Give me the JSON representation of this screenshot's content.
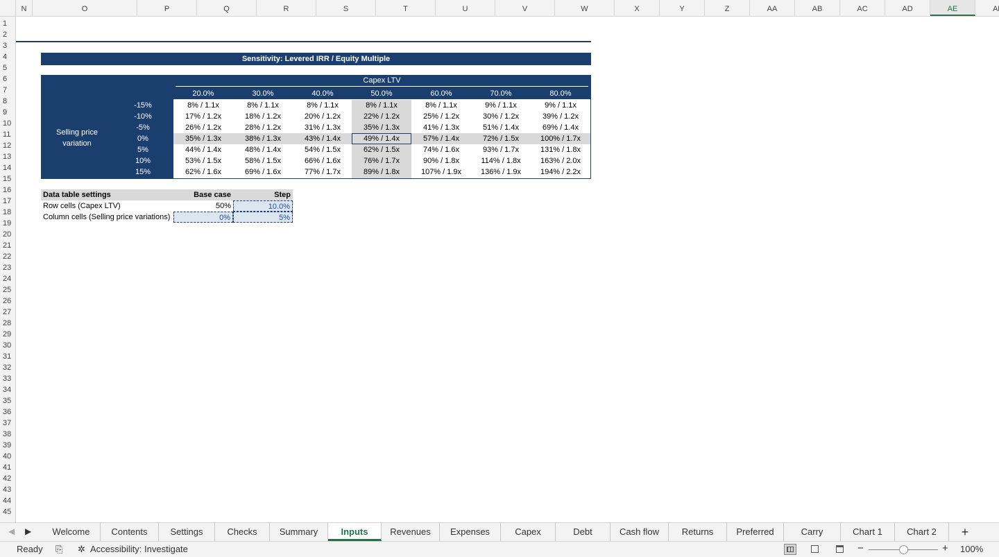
{
  "columns": [
    "N",
    "O",
    "P",
    "Q",
    "R",
    "S",
    "T",
    "U",
    "V",
    "W",
    "X",
    "Y",
    "Z",
    "AA",
    "AB",
    "AC",
    "AD",
    "AE",
    "AF"
  ],
  "selected_column": "AE",
  "rows": [
    "1",
    "2",
    "3",
    "4",
    "5",
    "6",
    "7",
    "8",
    "9",
    "10",
    "11",
    "12",
    "13",
    "14",
    "15",
    "16",
    "17",
    "18",
    "19",
    "20",
    "21",
    "22",
    "23",
    "24",
    "25",
    "26",
    "27",
    "28",
    "29",
    "30",
    "31",
    "32",
    "33",
    "34",
    "35",
    "36",
    "37",
    "38",
    "39",
    "40",
    "41",
    "42",
    "43",
    "44",
    "45"
  ],
  "sheet": {
    "title": "Sensitivity: Levered IRR / Equity Multiple",
    "col_axis_label": "Capex LTV",
    "row_axis_label": "Selling price variation",
    "col_values": [
      "20.0%",
      "30.0%",
      "40.0%",
      "50.0%",
      "60.0%",
      "70.0%",
      "80.0%"
    ],
    "row_values": [
      "-15%",
      "-10%",
      "-5%",
      "0%",
      "5%",
      "10%",
      "15%"
    ],
    "cells": [
      [
        "8% / 1.1x",
        "8% / 1.1x",
        "8% / 1.1x",
        "8% / 1.1x",
        "8% / 1.1x",
        "9% / 1.1x",
        "9% / 1.1x"
      ],
      [
        "17% / 1.2x",
        "18% / 1.2x",
        "20% / 1.2x",
        "22% / 1.2x",
        "25% / 1.2x",
        "30% / 1.2x",
        "39% / 1.2x"
      ],
      [
        "26% / 1.2x",
        "28% / 1.2x",
        "31% / 1.3x",
        "35% / 1.3x",
        "41% / 1.3x",
        "51% / 1.4x",
        "69% / 1.4x"
      ],
      [
        "35% / 1.3x",
        "38% / 1.3x",
        "43% / 1.4x",
        "49% / 1.4x",
        "57% / 1.4x",
        "72% / 1.5x",
        "100% / 1.7x"
      ],
      [
        "44% / 1.4x",
        "48% / 1.4x",
        "54% / 1.5x",
        "62% / 1.5x",
        "74% / 1.6x",
        "93% / 1.7x",
        "131% / 1.8x"
      ],
      [
        "53% / 1.5x",
        "58% / 1.5x",
        "66% / 1.6x",
        "76% / 1.7x",
        "90% / 1.8x",
        "114% / 1.8x",
        "163% / 2.0x"
      ],
      [
        "62% / 1.6x",
        "69% / 1.6x",
        "77% / 1.7x",
        "89% / 1.8x",
        "107% / 1.9x",
        "136% / 1.9x",
        "194% / 2.2x"
      ]
    ],
    "settings": {
      "header": "Data table settings",
      "base_label": "Base case",
      "step_label": "Step",
      "rows": [
        {
          "label": "Row cells (Capex LTV)",
          "base": "50%",
          "step": "10.0%"
        },
        {
          "label": "Column cells (Selling price variations)",
          "base": "0%",
          "step": "5%"
        }
      ]
    }
  },
  "tabs": [
    "Welcome",
    "Contents",
    "Settings",
    "Checks",
    "Summary",
    "Inputs",
    "Revenues",
    "Expenses",
    "Capex",
    "Debt",
    "Cash flow",
    "Returns",
    "Preferred",
    "Carry",
    "Chart 1",
    "Chart 2"
  ],
  "active_tab": "Inputs",
  "add_tab_label": "+",
  "status": {
    "ready": "Ready",
    "accessibility": "Accessibility: Investigate",
    "zoom": "100%",
    "zoom_level": 0.5
  },
  "colors": {
    "navy": "#1a3f6f",
    "accent": "#217346",
    "highlight": "#d9d9d9",
    "input_fill": "#dce6f1",
    "input_text": "#1f4e9c"
  }
}
